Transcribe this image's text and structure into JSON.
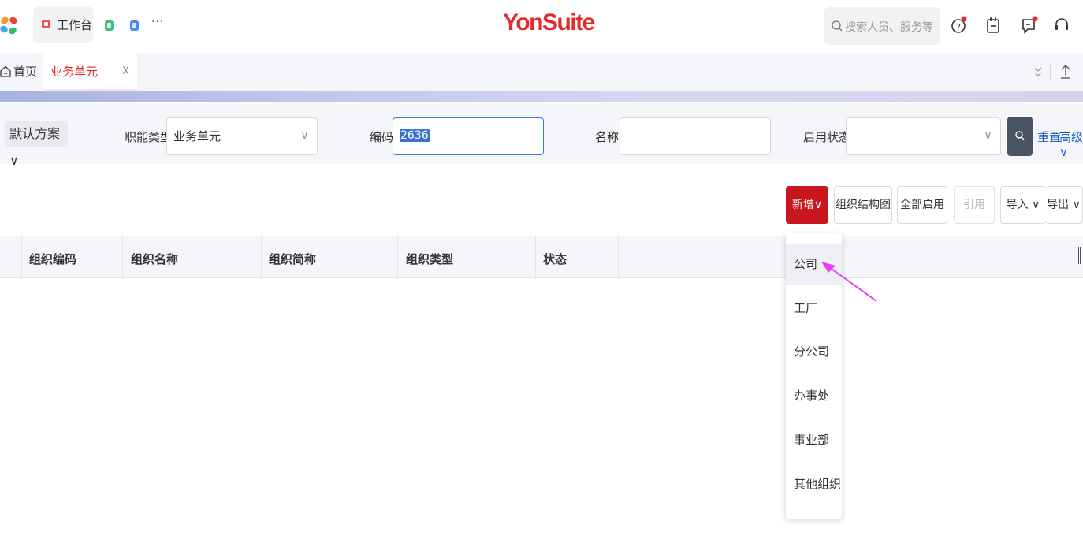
{
  "topbar": {
    "app_tab_label": "工作台",
    "more_label": "···",
    "brand": "YonSuite",
    "search_placeholder": "搜索人员、服务等"
  },
  "tabs": {
    "home_label": "首页",
    "active_label": "业务单元",
    "close_label": "X"
  },
  "filters": {
    "scheme_label": "默认方案 ∨",
    "type_label": "职能类型",
    "type_value": "业务单元",
    "code_label": "编码",
    "code_value": "2636",
    "name_label": "名称",
    "name_value": "",
    "status_label": "启用状态",
    "status_value": "",
    "chevron": "∨",
    "reset_label": "重置",
    "advanced_label": "高级∨"
  },
  "toolbar": {
    "new_label": "新增∨",
    "org_chart_label": "组织结构图",
    "enable_all_label": "全部启用",
    "reference_label": "引用",
    "import_label": "导入 ∨",
    "export_label": "导出 ∨"
  },
  "table": {
    "columns": [
      "组织编码",
      "组织名称",
      "组织简称",
      "组织类型",
      "状态"
    ]
  },
  "dropdown": {
    "items": [
      "公司",
      "工厂",
      "分公司",
      "办事处",
      "事业部",
      "其他组织"
    ],
    "hovered_index": 0
  },
  "colors": {
    "brand_red": "#e02c2c",
    "primary_button": "#c8161f",
    "link_blue": "#1a5fc9",
    "annotation_arrow": "#e83ef0"
  },
  "icons": [
    "app-grid-logo",
    "home-icon",
    "search-icon",
    "help-icon",
    "calendar-icon",
    "message-icon",
    "headset-icon",
    "collapse-icon",
    "upload-icon"
  ]
}
